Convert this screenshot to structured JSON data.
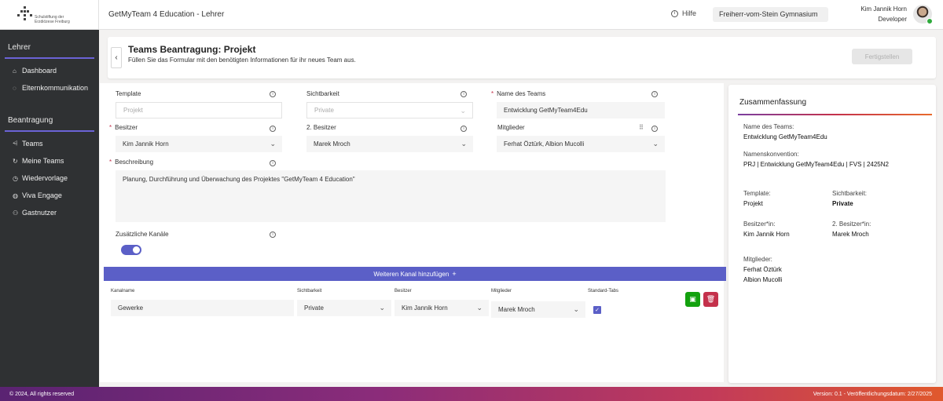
{
  "logo": {
    "line1": "Schulstiftung der",
    "line2": "Erzdiözese Freiburg"
  },
  "app": {
    "title": "GetMyTeam 4 Education - Lehrer"
  },
  "header": {
    "help_label": "Hilfe",
    "school": "Freiherr-vom-Stein Gymnasium",
    "user_name": "Kim Jannik Horn",
    "user_role": "Developer"
  },
  "sidebar": {
    "section_lehrer": "Lehrer",
    "lehrer_items": [
      {
        "label": "Dashboard",
        "icon": "home-icon"
      },
      {
        "label": "Elternkommunikation",
        "icon": "chat-icon"
      }
    ],
    "section_beantragung": "Beantragung",
    "beantragung_items": [
      {
        "label": "Teams",
        "icon": "teams-icon"
      },
      {
        "label": "Meine Teams",
        "icon": "refresh-icon"
      },
      {
        "label": "Wiedervorlage",
        "icon": "clock-icon"
      },
      {
        "label": "Viva Engage",
        "icon": "globe-icon"
      },
      {
        "label": "Gastnutzer",
        "icon": "guests-icon"
      }
    ]
  },
  "page": {
    "title": "Teams Beantragung: Projekt",
    "subtitle": "Füllen Sie das Formular mit den benötigten Informationen für ihr neues Team aus.",
    "submit_label": "Fertigstellen"
  },
  "form": {
    "template": {
      "label": "Template",
      "placeholder": "Projekt"
    },
    "visibility": {
      "label": "Sichtbarkeit",
      "placeholder": "Private"
    },
    "team_name": {
      "label": "Name des Teams",
      "value": "Entwicklung GetMyTeam4Edu"
    },
    "owner": {
      "label": "Besitzer",
      "value": "Kim Jannik Horn"
    },
    "owner2": {
      "label": "2. Besitzer",
      "value": "Marek Mroch"
    },
    "members": {
      "label": "Mitglieder",
      "value": "Ferhat Öztürk, Albion Mucolli"
    },
    "description": {
      "label": "Beschreibung",
      "value": "Planung, Durchführung und Überwachung des Projektes \"GetMyTeam 4 Education\""
    },
    "extra_channels": {
      "label": "Zusätzliche Kanäle",
      "enabled": true
    },
    "add_channel_label": "Weiteren Kanal hinzufügen",
    "channel_headers": [
      "Kanalname",
      "Sichtbarkeit",
      "Besitzer",
      "Mitglieder",
      "Standard-Tabs"
    ],
    "channel_row": {
      "name": "Gewerke",
      "visibility": "Private",
      "owner": "Kim Jannik Horn",
      "members": "Marek Mroch",
      "standard_tabs": true
    }
  },
  "summary": {
    "title": "Zusammenfassung",
    "team_name_label": "Name des Teams:",
    "team_name": "Entwicklung GetMyTeam4Edu",
    "naming_label": "Namenskonvention:",
    "naming": "PRJ | Entwicklung GetMyTeam4Edu | FVS | 2425N2",
    "template_label": "Template:",
    "template": "Projekt",
    "visibility_label": "Sichtbarkeit:",
    "visibility": "Private",
    "owner_label": "Besitzer*in:",
    "owner": "Kim Jannik Horn",
    "owner2_label": "2. Besitzer*in:",
    "owner2": "Marek Mroch",
    "members_label": "Mitglieder:",
    "member1": "Ferhat Öztürk",
    "member2": "Albion Mucolli"
  },
  "footer": {
    "copyright": "© 2024, All rights reserved",
    "version": "Version: 0.1 - Veröffentlichungsdatum: 2/27/2025"
  },
  "colors": {
    "accent": "#5b5fc7",
    "sidebar": "#2f3133",
    "danger": "#c4314b",
    "success": "#13a10e"
  }
}
